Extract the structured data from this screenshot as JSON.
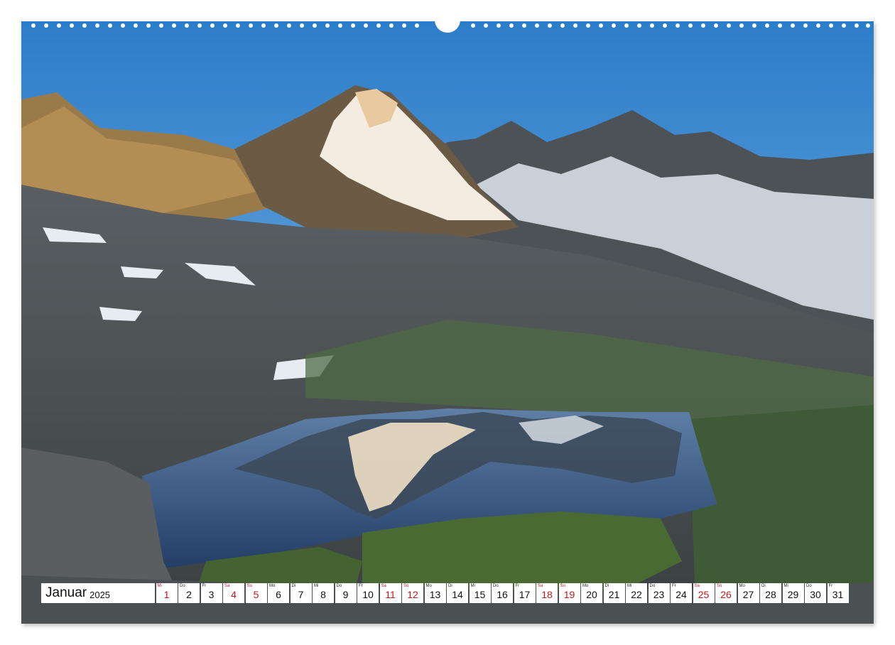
{
  "calendar": {
    "month": "Januar",
    "year": "2025",
    "days": [
      {
        "wd": "Mi",
        "num": "1",
        "red": true
      },
      {
        "wd": "Do",
        "num": "2",
        "red": false
      },
      {
        "wd": "Fr",
        "num": "3",
        "red": false
      },
      {
        "wd": "Sa",
        "num": "4",
        "red": true
      },
      {
        "wd": "So",
        "num": "5",
        "red": true
      },
      {
        "wd": "Mo",
        "num": "6",
        "red": false
      },
      {
        "wd": "Di",
        "num": "7",
        "red": false
      },
      {
        "wd": "Mi",
        "num": "8",
        "red": false
      },
      {
        "wd": "Do",
        "num": "9",
        "red": false
      },
      {
        "wd": "Fr",
        "num": "10",
        "red": false
      },
      {
        "wd": "Sa",
        "num": "11",
        "red": true
      },
      {
        "wd": "So",
        "num": "12",
        "red": true
      },
      {
        "wd": "Mo",
        "num": "13",
        "red": false
      },
      {
        "wd": "Di",
        "num": "14",
        "red": false
      },
      {
        "wd": "Mi",
        "num": "15",
        "red": false
      },
      {
        "wd": "Do",
        "num": "16",
        "red": false
      },
      {
        "wd": "Fr",
        "num": "17",
        "red": false
      },
      {
        "wd": "Sa",
        "num": "18",
        "red": true
      },
      {
        "wd": "So",
        "num": "19",
        "red": true
      },
      {
        "wd": "Mo",
        "num": "20",
        "red": false
      },
      {
        "wd": "Di",
        "num": "21",
        "red": false
      },
      {
        "wd": "Mi",
        "num": "22",
        "red": false
      },
      {
        "wd": "Do",
        "num": "23",
        "red": false
      },
      {
        "wd": "Fr",
        "num": "24",
        "red": false
      },
      {
        "wd": "Sa",
        "num": "25",
        "red": true
      },
      {
        "wd": "So",
        "num": "26",
        "red": true
      },
      {
        "wd": "Mo",
        "num": "27",
        "red": false
      },
      {
        "wd": "Di",
        "num": "28",
        "red": false
      },
      {
        "wd": "Mi",
        "num": "29",
        "red": false
      },
      {
        "wd": "Do",
        "num": "30",
        "red": false
      },
      {
        "wd": "Fr",
        "num": "31",
        "red": false
      }
    ]
  },
  "colors": {
    "sunday_red": "#c4161c",
    "sky_top": "#2c7dc9",
    "sky_bottom": "#8cc0ec",
    "lake": "#2f4f78"
  }
}
